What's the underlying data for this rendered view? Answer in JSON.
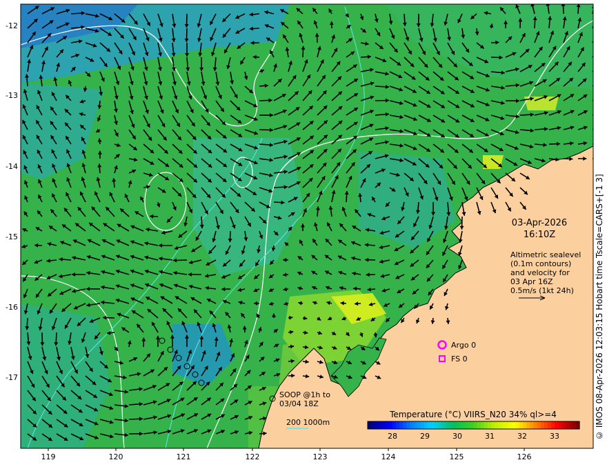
{
  "map": {
    "x_ticks": [
      "119",
      "120",
      "121",
      "122",
      "123",
      "124",
      "125",
      "126"
    ],
    "y_ticks": [
      "-12",
      "-13",
      "-14",
      "-15",
      "-16",
      "-17"
    ],
    "colors": {
      "ocean_base": "#35b34a",
      "land": "#fccf9e",
      "coast": "#000000",
      "contour": "#ffffff",
      "bathy": "#5fe8e8",
      "marker": "#ff00ff"
    }
  },
  "annotations": {
    "date": "03-Apr-2026",
    "time": "16:10Z",
    "altimetry_lines": [
      "Altimetric sealevel",
      "(0.1m contours)",
      "and velocity for",
      "03 Apr 16Z",
      "0.5m/s (1kt 24h)"
    ],
    "argo_label": "Argo 0",
    "fs_label": "FS 0",
    "soop_lines": [
      "SOOP @1h to",
      "03/04 18Z"
    ],
    "bathy_legend": "200  1000m"
  },
  "colorbar": {
    "title": "Temperature (°C) VIIRS_N20 34% ql>=4",
    "ticks": [
      "28",
      "29",
      "30",
      "31",
      "32",
      "33"
    ],
    "colors": [
      "#00007f",
      "#0000ff",
      "#0080ff",
      "#00d0ff",
      "#00c060",
      "#40d020",
      "#c0f000",
      "#ffff00",
      "#ff8000",
      "#ff0000",
      "#800000"
    ]
  },
  "credit": "© IMOS 08-Apr-2026 12:03:15 Hobart time Tscale=CARS+[-1 3]"
}
